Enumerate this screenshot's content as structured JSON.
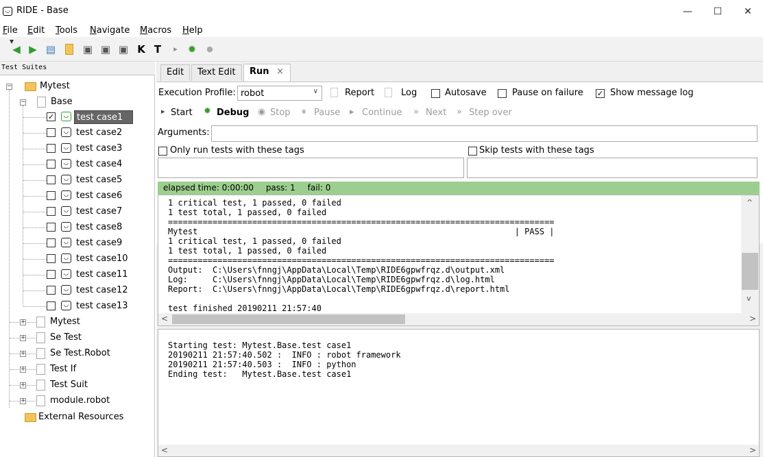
{
  "window": {
    "title": "RIDE - Base",
    "app_icon": "robot-icon",
    "min": "—",
    "max": "☐",
    "close": "✕"
  },
  "menu": [
    {
      "pre": "",
      "u": "F",
      "post": "ile"
    },
    {
      "pre": "",
      "u": "E",
      "post": "dit"
    },
    {
      "pre": "",
      "u": "T",
      "post": "ools"
    },
    {
      "pre": "",
      "u": "N",
      "post": "avigate"
    },
    {
      "pre": "",
      "u": "M",
      "post": "acros"
    },
    {
      "pre": "",
      "u": "H",
      "post": "elp"
    }
  ],
  "toolbar_icons": [
    "back-arrow-icon",
    "forward-arrow-icon",
    "open-folder-icon",
    "new-file-icon",
    "edit-icon",
    "edit-icon",
    "edit-icon",
    "keyword-search-icon",
    "test-search-icon",
    "run-icon",
    "debug-bug-icon",
    "stop-icon"
  ],
  "tree": {
    "header": "Test Suites",
    "root": "Mytest",
    "base": "Base",
    "cases": [
      {
        "label": "test case1",
        "checked": true
      },
      {
        "label": "test case2",
        "checked": false
      },
      {
        "label": "test case3",
        "checked": false
      },
      {
        "label": "test case4",
        "checked": false
      },
      {
        "label": "test case5",
        "checked": false
      },
      {
        "label": "test case6",
        "checked": false
      },
      {
        "label": "test case7",
        "checked": false
      },
      {
        "label": "test case8",
        "checked": false
      },
      {
        "label": "test case9",
        "checked": false
      },
      {
        "label": "test case10",
        "checked": false
      },
      {
        "label": "test case11",
        "checked": false
      },
      {
        "label": "test case12",
        "checked": false
      },
      {
        "label": "test case13",
        "checked": false
      }
    ],
    "siblings": [
      "Mytest",
      "Se Test",
      "Se Test.Robot",
      "Test If",
      "Test Suit",
      "module.robot"
    ],
    "external": "External Resources"
  },
  "tabs": [
    {
      "label": "Edit"
    },
    {
      "label": "Text Edit"
    },
    {
      "label": "Run",
      "close": "×"
    }
  ],
  "run": {
    "profile_label": "Execution Profile:",
    "profile_value": "robot",
    "report": "Report",
    "log": "Log",
    "autosave": "Autosave",
    "pause_on_failure": "Pause on failure",
    "show_message_log": "Show message log",
    "start": "Start",
    "debug": "Debug",
    "stop": "Stop",
    "pause": "Pause",
    "continue": "Continue",
    "next": "Next",
    "step_over": "Step over",
    "arguments_label": "Arguments:",
    "only_run_tags": "Only run tests with these tags",
    "skip_tags": "Skip tests with these tags"
  },
  "status": {
    "elapsed": "elapsed time: 0:00:00",
    "pass": "pass: 1",
    "fail": "fail: 0",
    "color": "#9ccf8f"
  },
  "output_text": "1 critical test, 1 passed, 0 failed\n1 test total, 1 passed, 0 failed\n==============================================================================\nMytest                                                                | PASS |\n1 critical test, 1 passed, 0 failed\n1 test total, 1 passed, 0 failed\n==============================================================================\nOutput:  C:\\Users\\fnngj\\AppData\\Local\\Temp\\RIDE6gpwfrqz.d\\output.xml\nLog:     C:\\Users\\fnngj\\AppData\\Local\\Temp\\RIDE6gpwfrqz.d\\log.html\nReport:  C:\\Users\\fnngj\\AppData\\Local\\Temp\\RIDE6gpwfrqz.d\\report.html\n\ntest finished 20190211 21:57:40",
  "message_log": "Starting test: Mytest.Base.test case1\n20190211 21:57:40.502 :  INFO : robot framework\n20190211 21:57:40.503 :  INFO : python\nEnding test:   Mytest.Base.test case1"
}
